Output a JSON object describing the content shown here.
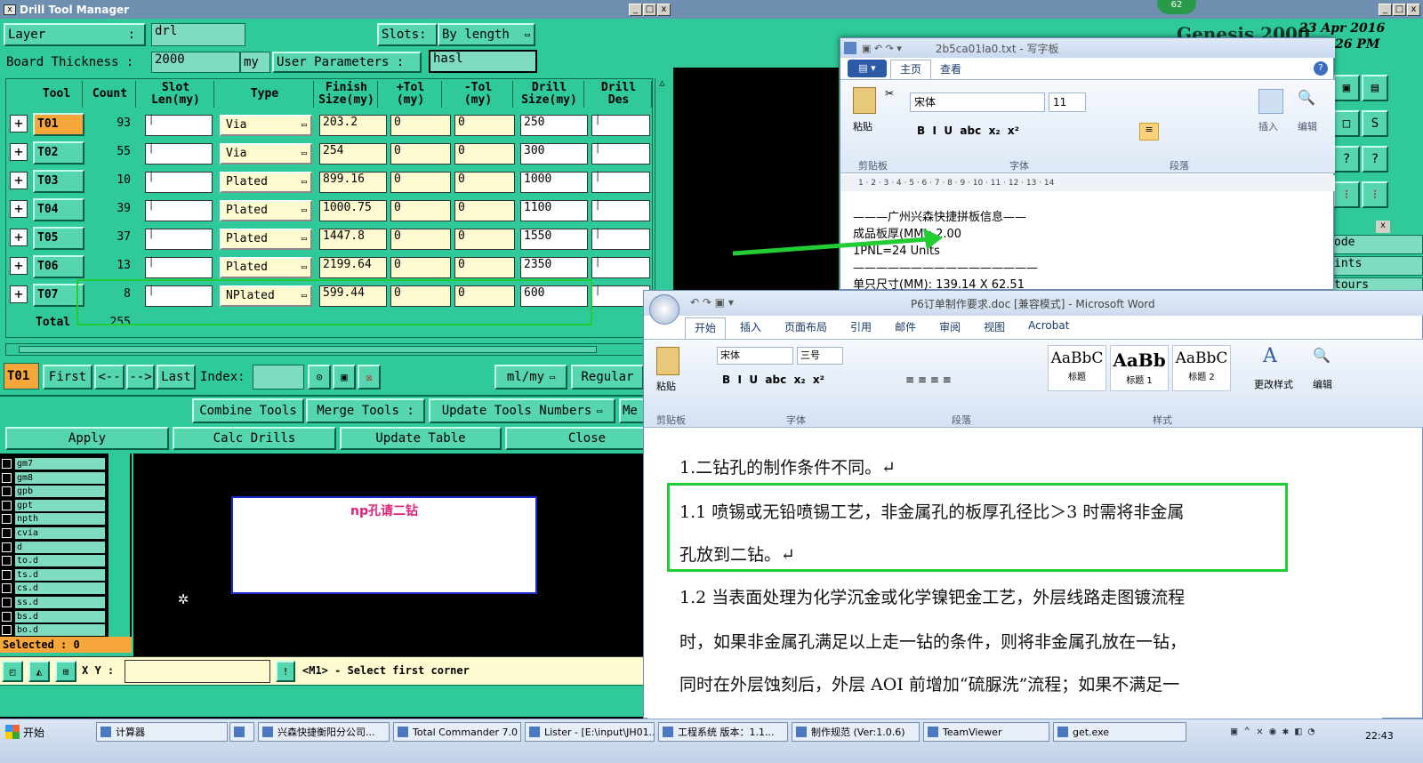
{
  "drill_window": {
    "title": "Drill Tool Manager",
    "layer_label": "Layer",
    "layer_colon": ":",
    "layer_value": "drl",
    "slots_label": "Slots:",
    "slots_value": "By length",
    "thickness_label": "Board Thickness :",
    "thickness_value": "2000",
    "thickness_unit": "my",
    "user_params_label": "User Parameters :",
    "user_params_value": "hasl",
    "columns": [
      "Tool",
      "Count",
      "Slot\nLen(my)",
      "Type",
      "Finish\nSize(my)",
      "+Tol\n(my)",
      "-Tol\n(my)",
      "Drill\nSize(my)",
      "Drill\nDes"
    ],
    "rows": [
      {
        "tool": "T01",
        "count": "93",
        "type": "Via",
        "finish": "203.2",
        "ptol": "0",
        "mtol": "0",
        "drill": "250"
      },
      {
        "tool": "T02",
        "count": "55",
        "type": "Via",
        "finish": "254",
        "ptol": "0",
        "mtol": "0",
        "drill": "300"
      },
      {
        "tool": "T03",
        "count": "10",
        "type": "Plated",
        "finish": "899.16",
        "ptol": "0",
        "mtol": "0",
        "drill": "1000"
      },
      {
        "tool": "T04",
        "count": "39",
        "type": "Plated",
        "finish": "1000.75",
        "ptol": "0",
        "mtol": "0",
        "drill": "1100"
      },
      {
        "tool": "T05",
        "count": "37",
        "type": "Plated",
        "finish": "1447.8",
        "ptol": "0",
        "mtol": "0",
        "drill": "1550"
      },
      {
        "tool": "T06",
        "count": "13",
        "type": "Plated",
        "finish": "2199.64",
        "ptol": "0",
        "mtol": "0",
        "drill": "2350"
      },
      {
        "tool": "T07",
        "count": "8",
        "type": "NPlated",
        "finish": "599.44",
        "ptol": "0",
        "mtol": "0",
        "drill": "600"
      }
    ],
    "total_label": "Total",
    "total_value": "255",
    "current_tool": "T01",
    "nav": {
      "first": "First",
      "prev": "<--",
      "next": "-->",
      "last": "Last",
      "index": "Index:"
    },
    "units_value": "ml/my",
    "regular": "Regular",
    "combine": "Combine Tools",
    "merge": "Merge Tools :",
    "update_nums": "Update Tools Numbers",
    "me": "Me",
    "apply": "Apply",
    "calc": "Calc Drills",
    "update_table": "Update Table",
    "close": "Close"
  },
  "layers": [
    "gm7",
    "gm8",
    "gpb",
    "gpt",
    "npth",
    "cvia",
    "d",
    "to.d",
    "ts.d",
    "cs.d",
    "ss.d",
    "bs.d",
    "bo.d"
  ],
  "selected_label": "Selected : 0",
  "canvas_note": "np孔请二钻",
  "xy_label": "X Y :",
  "status_msg": "<M1> - Select first corner",
  "genesis": {
    "title": "Genesis 2000",
    "date": "23 Apr 2016",
    "time": "26 PM",
    "badge": "62",
    "side": [
      "ode",
      "ints",
      "tours"
    ]
  },
  "wordpad": {
    "title": "2b5ca01la0.txt - 写字板",
    "tabs": [
      "主页",
      "查看"
    ],
    "font": "宋体",
    "size": "11",
    "groups": [
      "剪贴板",
      "字体",
      "段落",
      "插入",
      "编辑"
    ],
    "paste": "粘贴",
    "ruler": "1 · 2 · 3 · 4 · 5 · 6 · 7 · 8 · 9 · 10 · 11 · 12 · 13 · 14",
    "lines": [
      "———广州兴森快捷拼板信息——",
      "成品板厚(MM): 2.00",
      "1PNL=24 Units",
      "————————————————",
      "单只尺寸(MM): 139.14 X 62.51"
    ]
  },
  "word": {
    "title": "P6订单制作要求.doc [兼容模式] - Microsoft Word",
    "tabs": [
      "开始",
      "插入",
      "页面布局",
      "引用",
      "邮件",
      "审阅",
      "视图",
      "Acrobat"
    ],
    "font": "宋体",
    "size": "三号",
    "groups": [
      "剪贴板",
      "字体",
      "段落",
      "样式"
    ],
    "paste": "粘贴",
    "styles": [
      {
        "preview": "AaBbC",
        "name": "标题"
      },
      {
        "preview": "AaBb",
        "name": "标题 1"
      },
      {
        "preview": "AaBbC",
        "name": "标题 2"
      }
    ],
    "change_styles": "更改样式",
    "edit": "编辑",
    "paragraphs": [
      "1.二钻孔的制作条件不同。↵",
      "1.1 喷锡或无铅喷锡工艺，非金属孔的板厚孔径比＞3 时需将非金属",
      "孔放到二钻。↵",
      "1.2 当表面处理为化学沉金或化学镍钯金工艺，外层线路走图镀流程",
      "时，如果非金属孔满足以上走一钻的条件，则将非金属孔放在一钻，",
      "同时在外层蚀刻后，外层 AOI 前增加“硫脲洗”流程；如果不满足一"
    ]
  },
  "taskbar": {
    "start": "开始",
    "items": [
      "计算器",
      "",
      "兴森快捷衡阳分公司...",
      "Total Commander 7.0 ...",
      "Lister - [E:\\input\\JH01...",
      "工程系统  版本：1.1...",
      "制作规范 (Ver:1.0.6)",
      "TeamViewer",
      "get.exe"
    ],
    "clock": "22:43"
  },
  "colors": {
    "teal": "#2fc99a",
    "highlight": "#22cc33",
    "accent": "#1b3a66"
  }
}
